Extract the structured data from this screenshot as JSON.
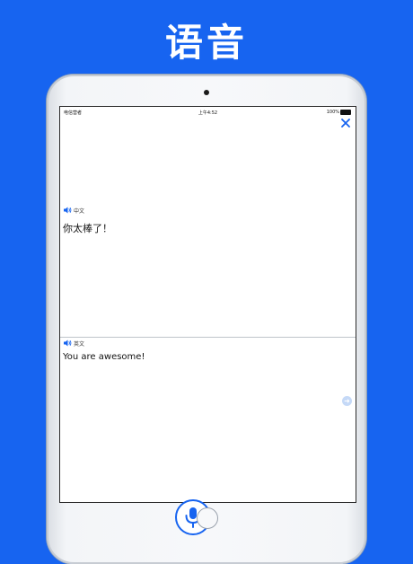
{
  "headline": "语音",
  "status": {
    "carrier": "电信营者",
    "time": "上午4:52",
    "battery": "100%"
  },
  "source": {
    "language": "中文",
    "text": "你太棒了！"
  },
  "target": {
    "language": "英文",
    "text": "You are awesome!"
  },
  "icons": {
    "close": "close-icon",
    "speaker": "speaker-icon",
    "next": "arrow-right-icon",
    "mic": "microphone-icon"
  },
  "colors": {
    "background": "#1764f0",
    "accent": "#1764f0"
  }
}
